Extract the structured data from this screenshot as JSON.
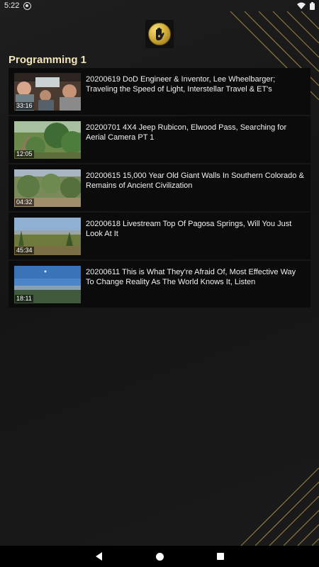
{
  "status_bar": {
    "time": "5:22",
    "icons": [
      "sync-icon",
      "wifi-icon",
      "battery-icon"
    ]
  },
  "app": {
    "logo": "hand-emblem-logo"
  },
  "section": {
    "title": "Programming 1"
  },
  "videos": [
    {
      "title": "20200619 DoD Engineer & Inventor, Lee Wheelbarger; Traveling the Speed of Light, Interstellar Travel & ET's",
      "duration": "33:16"
    },
    {
      "title": "20200701 4X4 Jeep Rubicon, Elwood Pass, Searching for Aerial Camera PT 1",
      "duration": "12:05"
    },
    {
      "title": "20200615 15,000 Year Old Giant Walls In Southern Colorado & Remains of Ancient Civilization",
      "duration": "04:32"
    },
    {
      "title": "20200618 Livestream Top Of Pagosa Springs, Will You Just Look At It",
      "duration": "45:34"
    },
    {
      "title": "20200611 This is What They're Afraid Of, Most Effective Way To Change Reality As The World Knows It, Listen",
      "duration": "18:11"
    }
  ],
  "nav_bar": {
    "icons": [
      "back-icon",
      "home-icon",
      "recents-icon"
    ]
  },
  "colors": {
    "accent_gold": "#d4af37",
    "section_title": "#f4e6b8",
    "item_bg": "#0b0b0b"
  }
}
